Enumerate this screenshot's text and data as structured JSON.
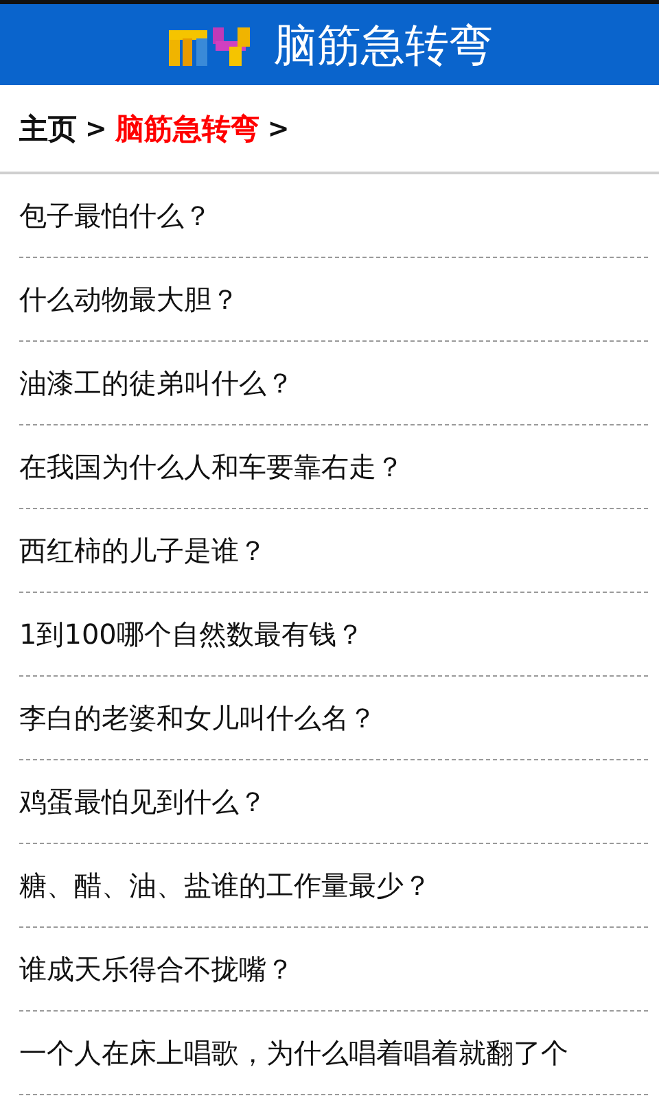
{
  "header": {
    "title": "脑筋急转弯"
  },
  "breadcrumb": [
    {
      "label": "主页",
      "current": false
    },
    {
      "label": "脑筋急转弯",
      "current": true
    }
  ],
  "breadcrumb_separator": ">",
  "questions": [
    "包子最怕什么？",
    "什么动物最大胆？",
    "油漆工的徒弟叫什么？",
    "在我国为什么人和车要靠右走？",
    "西红柿的儿子是谁？",
    "1到100哪个自然数最有钱？",
    "李白的老婆和女儿叫什么名？",
    "鸡蛋最怕见到什么？",
    "糖、醋、油、盐谁的工作量最少？",
    "谁成天乐得合不拢嘴？",
    "一个人在床上唱歌，为什么唱着唱着就翻了个"
  ]
}
